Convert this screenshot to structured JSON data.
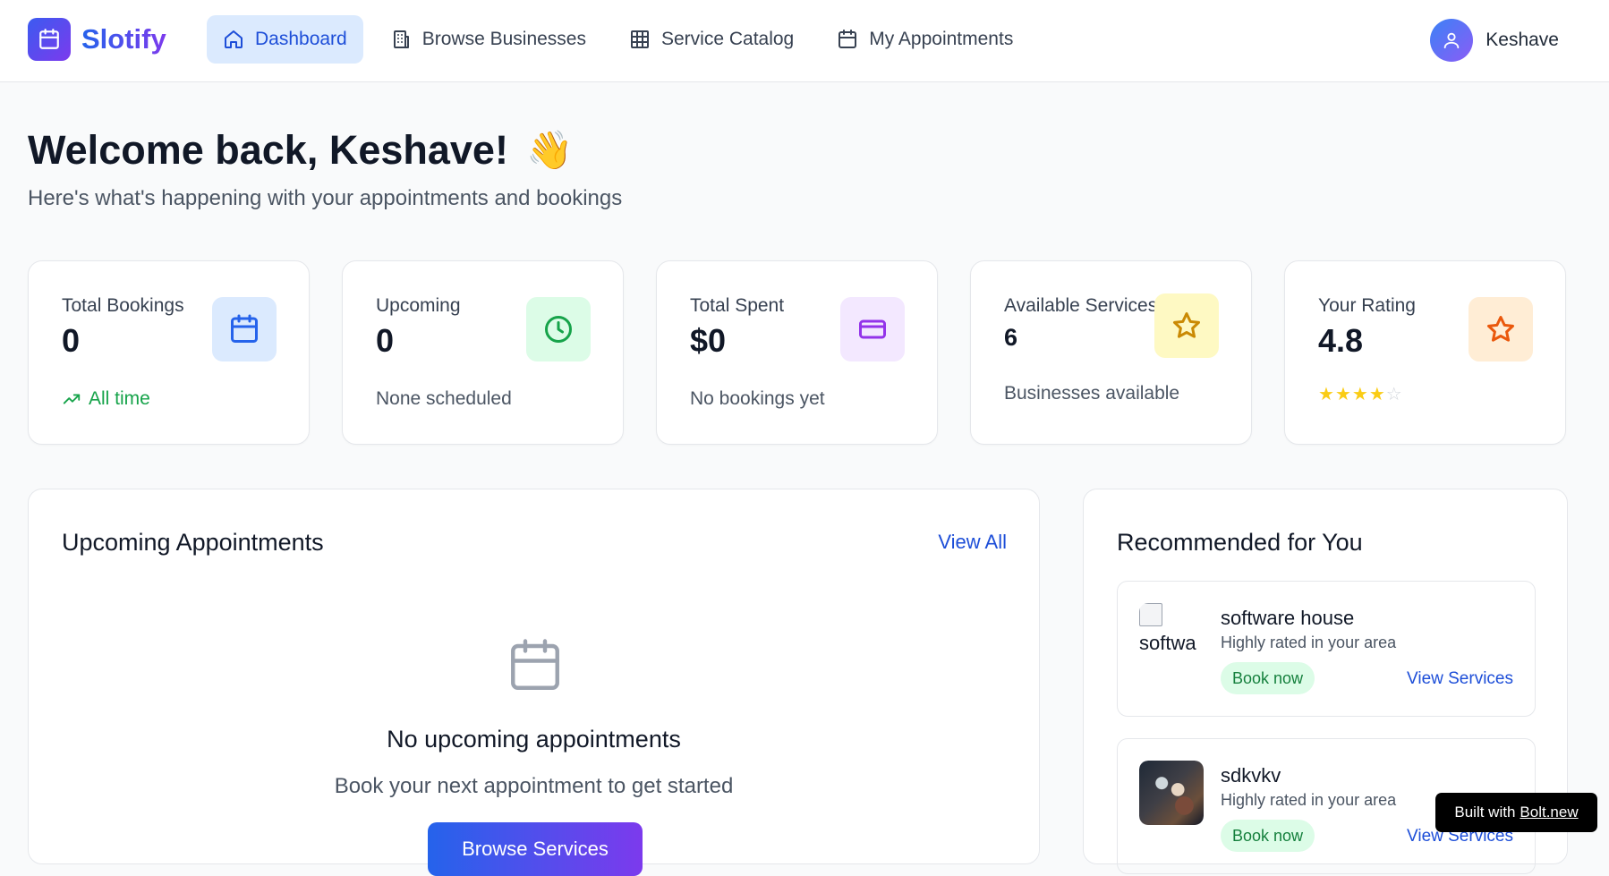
{
  "brand": {
    "name": "Slotify",
    "icon": "calendar-icon"
  },
  "nav": {
    "items": [
      {
        "label": "Dashboard",
        "icon": "home-icon",
        "active": true
      },
      {
        "label": "Browse Businesses",
        "icon": "building-icon",
        "active": false
      },
      {
        "label": "Service Catalog",
        "icon": "grid-icon",
        "active": false
      },
      {
        "label": "My Appointments",
        "icon": "calendar-icon",
        "active": false
      }
    ]
  },
  "user": {
    "name": "Keshave",
    "icon": "user-icon"
  },
  "welcome": {
    "title": "Welcome back, Keshave!",
    "emoji": "👋",
    "subtitle": "Here's what's happening with your appointments and bookings"
  },
  "stats": [
    {
      "label": "Total Bookings",
      "value": "0",
      "sub": "All time",
      "icon": "calendar-icon",
      "accent": "#2563eb",
      "bg": "#dbeafe"
    },
    {
      "label": "Upcoming",
      "value": "0",
      "sub": "None scheduled",
      "icon": "clock-icon",
      "accent": "#16a34a",
      "bg": "#dcfce7"
    },
    {
      "label": "Total Spent",
      "value": "$0",
      "sub": "No bookings yet",
      "icon": "credit-card-icon",
      "accent": "#9333ea",
      "bg": "#f3e8ff"
    },
    {
      "label": "Available Services",
      "value": "6",
      "sub": "Businesses available",
      "icon": "star-icon",
      "accent": "#ca8a04",
      "bg": "#fef9c3"
    },
    {
      "label": "Your Rating",
      "value": "4.8",
      "rating_stars": 4,
      "rating_max": 5,
      "icon": "star-icon",
      "accent": "#ea580c",
      "bg": "#ffedd5"
    }
  ],
  "appointments": {
    "title": "Upcoming Appointments",
    "view_all": "View All",
    "empty_title": "No upcoming appointments",
    "empty_text": "Book your next appointment to get started",
    "button": "Browse Services"
  },
  "recommended": {
    "title": "Recommended for You",
    "items": [
      {
        "name": "software house",
        "desc": "Highly rated in your area",
        "book": "Book now",
        "view": "View Services",
        "thumb_alt": "softwa"
      },
      {
        "name": "sdkvkv",
        "desc": "Highly rated in your area",
        "book": "Book now",
        "view": "View Services"
      }
    ]
  },
  "badge": {
    "prefix": "Built with",
    "link": "Bolt.new"
  }
}
